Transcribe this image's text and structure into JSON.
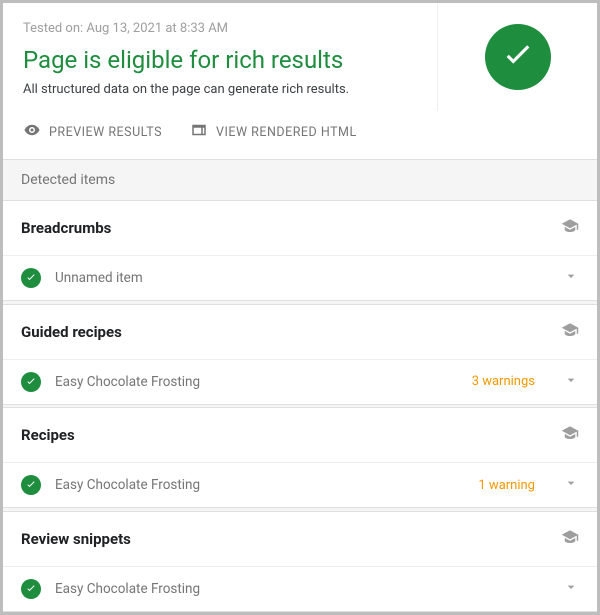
{
  "header": {
    "tested_prefix": "Tested on: ",
    "tested_value": "Aug 13, 2021 at 8:33 AM",
    "title": "Page is eligible for rich results",
    "subtitle": "All structured data on the page can generate rich results."
  },
  "actions": {
    "preview": "PREVIEW RESULTS",
    "rendered": "VIEW RENDERED HTML"
  },
  "section_label": "Detected items",
  "categories": [
    {
      "title": "Breadcrumbs",
      "items": [
        {
          "label": "Unnamed item",
          "warning": ""
        }
      ]
    },
    {
      "title": "Guided recipes",
      "items": [
        {
          "label": "Easy Chocolate Frosting",
          "warning": "3 warnings"
        }
      ]
    },
    {
      "title": "Recipes",
      "items": [
        {
          "label": "Easy Chocolate Frosting",
          "warning": "1 warning"
        }
      ]
    },
    {
      "title": "Review snippets",
      "items": [
        {
          "label": "Easy Chocolate Frosting",
          "warning": ""
        }
      ]
    }
  ]
}
